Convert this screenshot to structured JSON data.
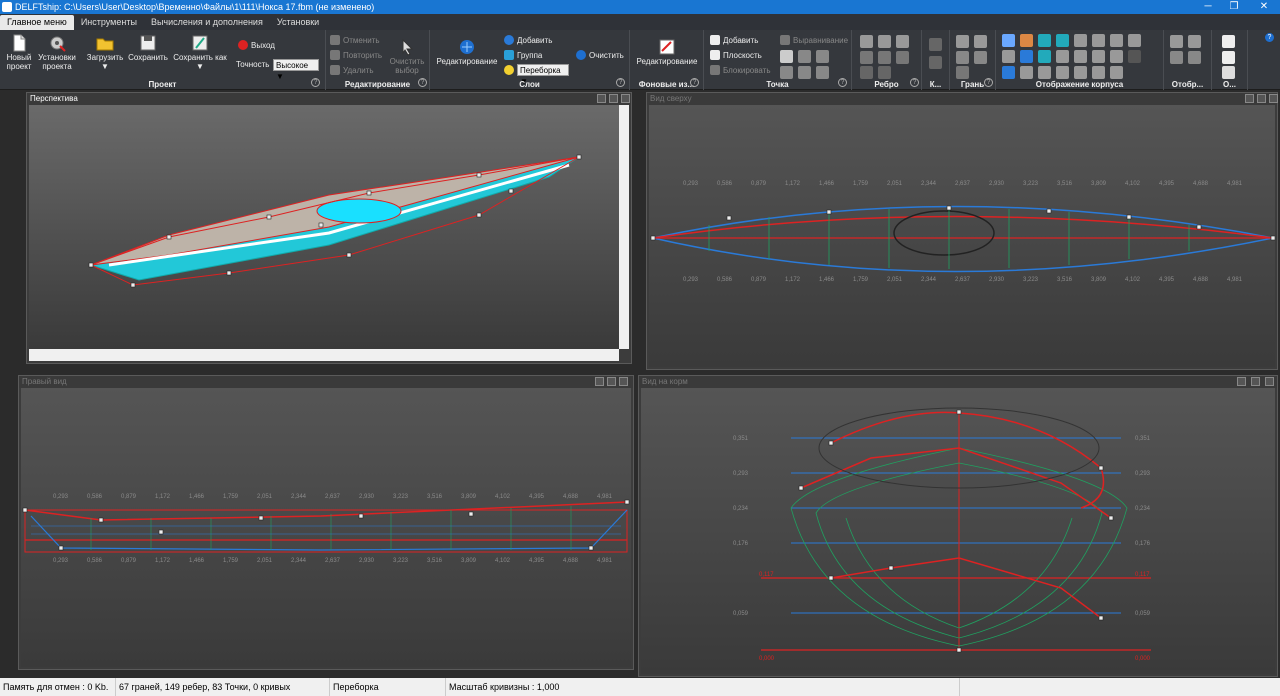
{
  "window": {
    "title": "DELFTship: C:\\Users\\User\\Desktop\\Временно\\Файлы\\1\\111\\Нокса 17.fbm (не изменено)",
    "minimize": "─",
    "maximize": "❐",
    "close": "✕"
  },
  "menu": {
    "tabs": [
      "Главное меню",
      "Инструменты",
      "Вычисления и дополнения",
      "Установки"
    ]
  },
  "ribbon": {
    "project": {
      "title": "Проект",
      "new_label": "Новый проект",
      "setup_label": "Установки проекта",
      "load_label": "Загрузить",
      "save_label": "Сохранить",
      "save_as_label": "Сохранить как",
      "exit_label": "Выход",
      "precision_label": "Точность",
      "precision_value": "Высокое"
    },
    "edit": {
      "title": "Редактирование",
      "undo_label": "Отменить",
      "redo_label": "Повторить",
      "delete_label": "Удалить",
      "clear_selection_label": "Очистить выбор"
    },
    "layers": {
      "title": "Слои",
      "edit_label": "Редактирование",
      "add_label": "Добавить",
      "group_label": "Группа",
      "cycle_label": "Переборка",
      "clear_label": "Очистить"
    },
    "background": {
      "title": "Фоновые из...",
      "edit_label": "Редактирование"
    },
    "point": {
      "title": "Точка",
      "add_label": "Добавить",
      "plane_label": "Плоскость",
      "lock_label": "Блокировать",
      "align_label": "Выравнивание"
    },
    "edge": {
      "title": "Ребро"
    },
    "k": {
      "title": "К..."
    },
    "face": {
      "title": "Грань"
    },
    "hull_display": {
      "title": "Отображение корпуса"
    },
    "display": {
      "title": "Отобр..."
    },
    "o": {
      "title": "О..."
    },
    "help_glyph": "?"
  },
  "viewports": {
    "perspective": {
      "title": "Перспектива"
    },
    "top": {
      "title": "Вид сверху",
      "stations": [
        "0,293",
        "0,586",
        "0,879",
        "1,172",
        "1,466",
        "1,759",
        "2,051",
        "2,344",
        "2,637",
        "2,930",
        "3,223",
        "3,516",
        "3,809",
        "4,102",
        "4,395",
        "4,688",
        "4,981"
      ]
    },
    "side": {
      "title": "Правый вид",
      "stations": [
        "0,293",
        "0,586",
        "0,879",
        "1,172",
        "1,466",
        "1,759",
        "2,051",
        "2,344",
        "2,637",
        "2,930",
        "3,223",
        "3,516",
        "3,809",
        "4,102",
        "4,395",
        "4,688",
        "4,981"
      ]
    },
    "body": {
      "title": "Вид на корм",
      "waterlines_right": [
        "0,351",
        "0,293",
        "0,234",
        "0,176",
        "0,117",
        "0,059"
      ],
      "waterlines_left": [
        "0,351",
        "0,293",
        "0,234",
        "0,176",
        "0,117",
        "0,059"
      ],
      "base_label": "0,000",
      "dwl_label": "0,117"
    }
  },
  "status": {
    "undo_memory": "Память для отмен : 0 Kb.",
    "counts": "67 граней, 149 ребер, 83 Точки, 0 кривых",
    "mode": "Переборка",
    "curvature": "Масштаб кривизны : 1,000"
  },
  "colors": {
    "hull_cyan": "#22c8d8",
    "control_red": "#e02020",
    "station_green": "#20a060",
    "buttock_blue": "#2a7ad8",
    "titlebar": "#1976d2"
  }
}
